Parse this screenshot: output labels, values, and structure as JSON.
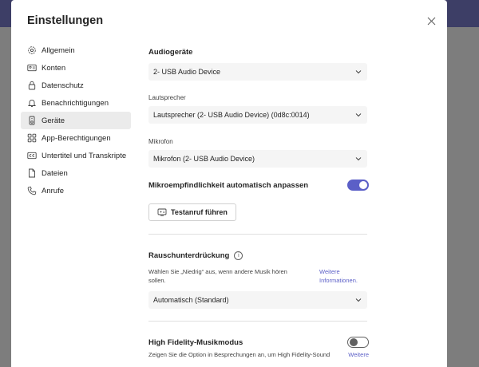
{
  "dialog": {
    "title": "Einstellungen"
  },
  "nav": {
    "items": [
      {
        "label": "Allgemein",
        "icon": "gear-icon"
      },
      {
        "label": "Konten",
        "icon": "id-card-icon"
      },
      {
        "label": "Datenschutz",
        "icon": "lock-icon"
      },
      {
        "label": "Benachrichtigungen",
        "icon": "bell-icon"
      },
      {
        "label": "Geräte",
        "icon": "device-icon",
        "active": true
      },
      {
        "label": "App-Berechtigungen",
        "icon": "grid-icon"
      },
      {
        "label": "Untertitel und Transkripte",
        "icon": "captions-icon"
      },
      {
        "label": "Dateien",
        "icon": "file-icon"
      },
      {
        "label": "Anrufe",
        "icon": "phone-icon"
      }
    ]
  },
  "audio": {
    "section_title": "Audiogeräte",
    "device_value": "2- USB Audio Device",
    "speaker_label": "Lautsprecher",
    "speaker_value": "Lautsprecher (2- USB Audio Device) (0d8c:0014)",
    "mic_label": "Mikrofon",
    "mic_value": "Mikrofon (2- USB Audio Device)",
    "auto_sensitivity_label": "Mikroempfindlichkeit automatisch anpassen",
    "auto_sensitivity_on": true,
    "test_call_label": "Testanruf führen"
  },
  "noise": {
    "title": "Rauschunterdrückung",
    "info_glyph": "i",
    "description": "Wählen Sie „Niedrig“ aus, wenn andere Musik hören sollen.",
    "link": "Weitere Informationen.",
    "value": "Automatisch (Standard)"
  },
  "hifi": {
    "title": "High Fidelity-Musikmodus",
    "on": false,
    "description": "Zeigen Sie die Option in Besprechungen an, um High Fidelity-Sound",
    "link": "Weitere"
  },
  "colors": {
    "accent": "#5b5fc7",
    "header_bg": "#3d3e66",
    "active_nav_bg": "#ebebeb"
  }
}
